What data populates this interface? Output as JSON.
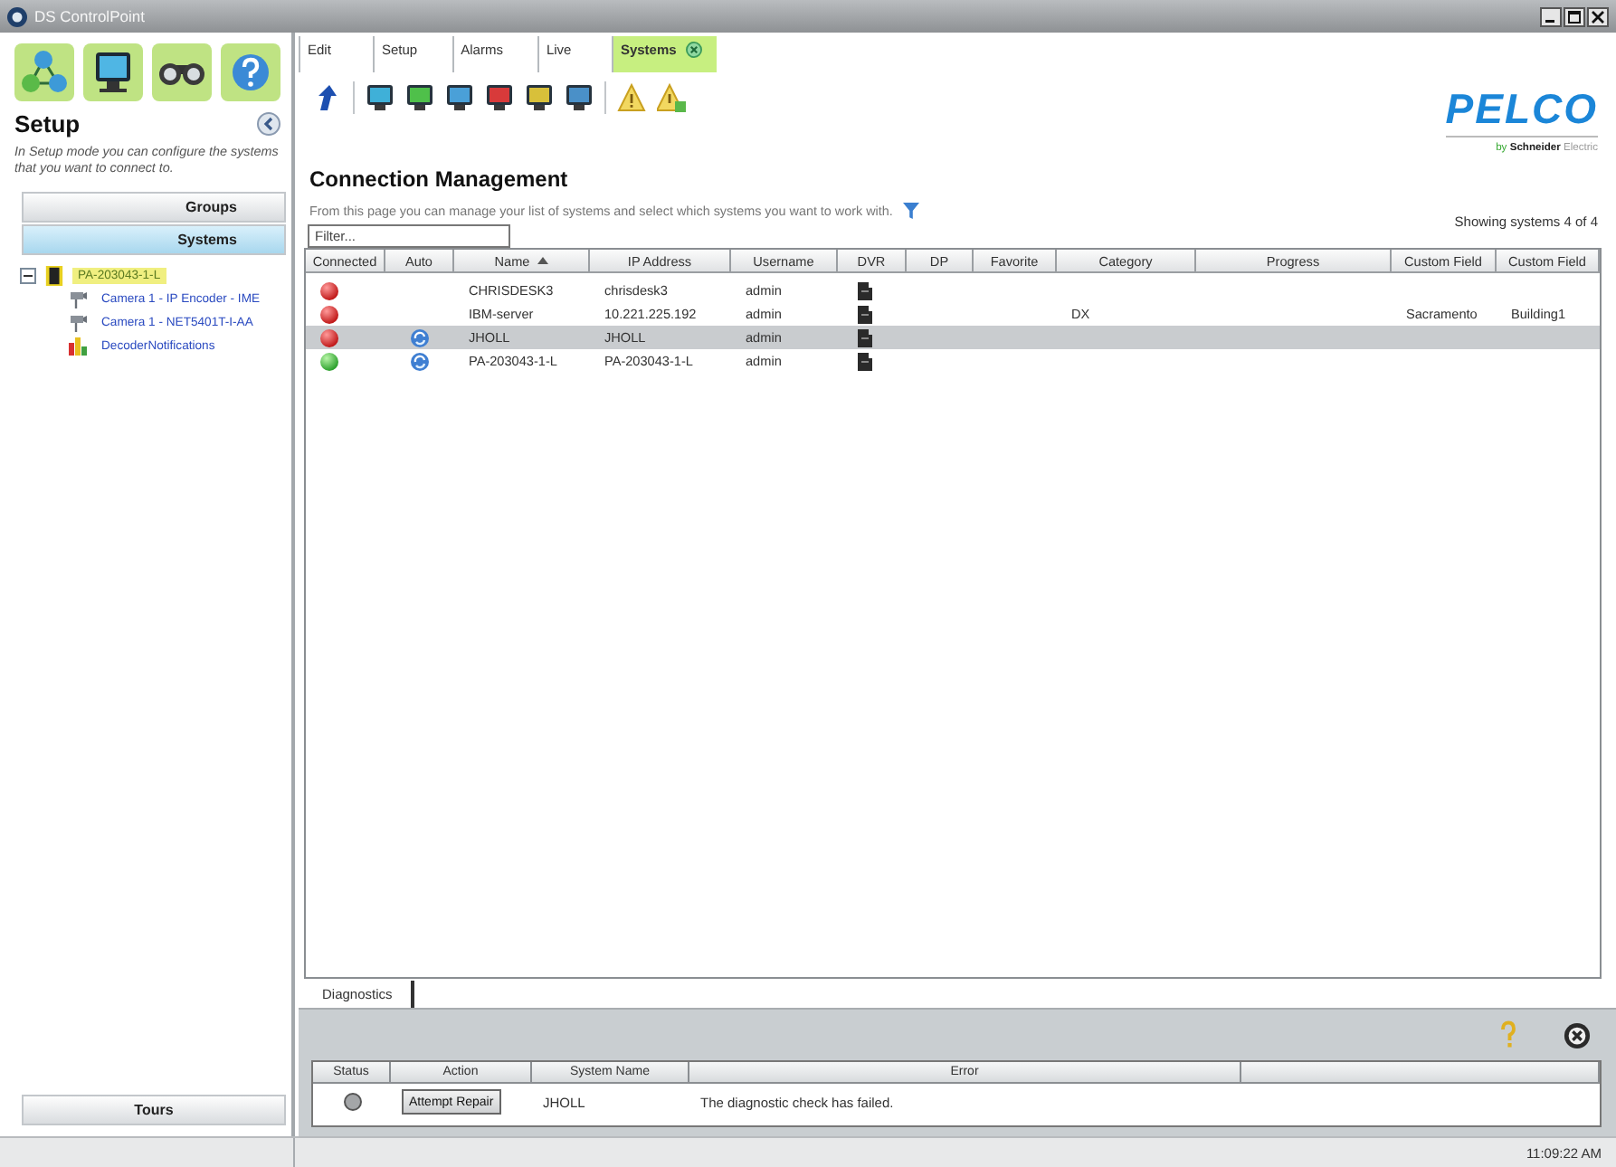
{
  "window": {
    "title": "DS ControlPoint"
  },
  "sidebar": {
    "title": "Setup",
    "description": "In Setup mode you can configure the systems that you want to connect to.",
    "sections": [
      {
        "label": "Groups",
        "selected": false
      },
      {
        "label": "Systems",
        "selected": true
      }
    ],
    "tree": [
      {
        "label": "PA-203043-1-L",
        "kind": "system",
        "selected": true,
        "expanded": true,
        "children": [
          {
            "label": "Camera 1 - IP Encoder - IME",
            "kind": "camera",
            "selected": false
          },
          {
            "label": "Camera 1 - NET5401T-I-AA",
            "kind": "camera",
            "selected": false
          },
          {
            "label": "DecoderNotifications",
            "kind": "chart",
            "selected": false
          }
        ]
      }
    ],
    "footer_button": "Tours"
  },
  "tabs": [
    {
      "label": "Edit",
      "selected": false,
      "closable": false
    },
    {
      "label": "Setup",
      "selected": false,
      "closable": false
    },
    {
      "label": "Alarms",
      "selected": false,
      "closable": false
    },
    {
      "label": "Live",
      "selected": false,
      "closable": false
    },
    {
      "label": "Systems",
      "selected": true,
      "closable": true
    }
  ],
  "page": {
    "title": "Connection Management",
    "description": "From this page you can manage your list of systems and select which systems you want to work with.",
    "filter": {
      "placeholder": "Filter..."
    },
    "count": "Showing systems 4 of 4"
  },
  "logo": {
    "name": "PELCO",
    "by": "by",
    "brand": "Schneider",
    "brand_suffix": "Electric"
  },
  "table": {
    "columns": [
      {
        "label": "Connected",
        "sorted": false
      },
      {
        "label": "Auto",
        "sorted": false
      },
      {
        "label": "Name",
        "sorted": true
      },
      {
        "label": "IP Address",
        "sorted": false
      },
      {
        "label": "Username",
        "sorted": false
      },
      {
        "label": "DVR",
        "sorted": false
      },
      {
        "label": "DP",
        "sorted": false
      },
      {
        "label": "Favorite",
        "sorted": false
      },
      {
        "label": "Category",
        "sorted": false
      },
      {
        "label": "Progress",
        "sorted": false
      },
      {
        "label": "Custom Field",
        "sorted": false
      },
      {
        "label": "Custom Field",
        "sorted": false
      }
    ],
    "rows": [
      {
        "selected": false,
        "connected": false,
        "auto": false,
        "name": "CHRISDESK3",
        "ip_address": "chrisdesk3",
        "username": "admin",
        "dvr": true
      },
      {
        "selected": false,
        "connected": false,
        "auto": false,
        "name": "IBM-server",
        "ip_address": "10.221.225.192",
        "username": "admin",
        "dvr": true,
        "category": "DX",
        "custom_field_1": "Sacramento",
        "custom_field_2": "Building1"
      },
      {
        "selected": true,
        "connected": false,
        "auto": true,
        "name": "JHOLL",
        "ip_address": "JHOLL",
        "username": "admin",
        "dvr": true
      },
      {
        "selected": false,
        "connected": true,
        "auto": true,
        "name": "PA-203043-1-L",
        "ip_address": "PA-203043-1-L",
        "username": "admin",
        "dvr": true
      }
    ]
  },
  "diagnostics": {
    "tab": "Diagnostics",
    "columns": [
      "Status",
      "Action",
      "System Name",
      "Error"
    ],
    "rows": [
      {
        "color": "#a4a6a8",
        "action": "Attempt Repair",
        "system_name": "JHOLL",
        "error": "The diagnostic check has failed."
      }
    ]
  },
  "status_bar": {
    "time": "11:09:22 AM"
  }
}
